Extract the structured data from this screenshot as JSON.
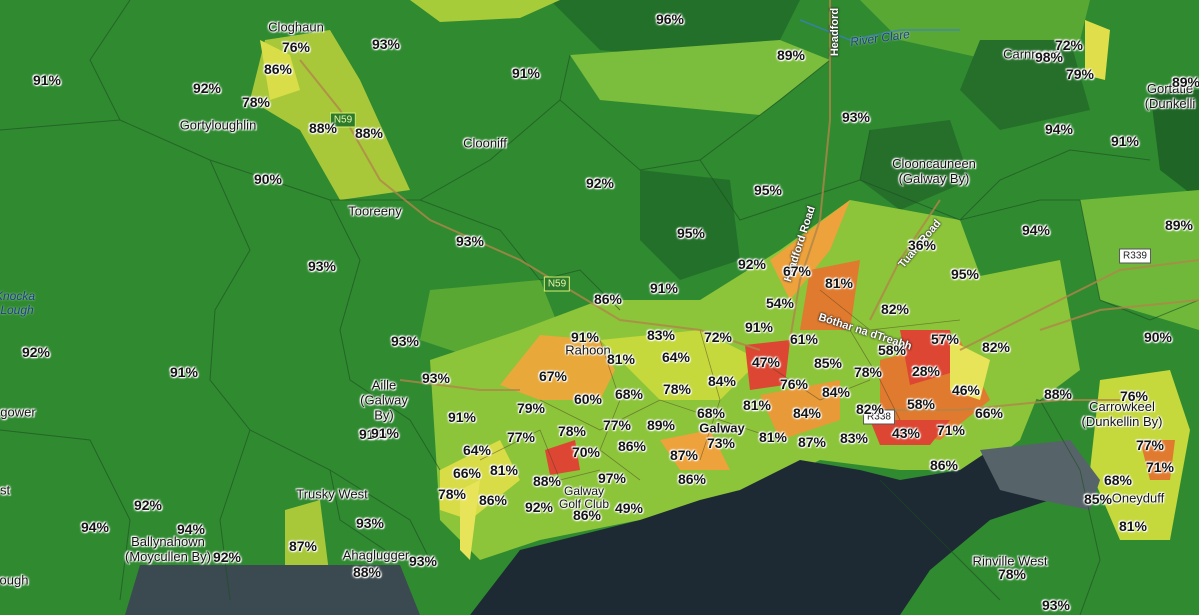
{
  "colors": {
    "background_green": "#2f8a30",
    "dark_green": "#23702a",
    "mid_green": "#3f9a35",
    "light_green": "#6fb83a",
    "yellow_green": "#c5d83c",
    "yellow": "#e8e45a",
    "orange": "#eea23c",
    "dark_orange": "#e07a2e",
    "red": "#dc4632",
    "sea": "#1d2a33"
  },
  "places": {
    "cloghaun": "Cloghaun",
    "gortyloughlin": "Gortyloughlin",
    "clooniff": "Clooniff",
    "tooreeny": "Tooreeny",
    "knocka": "Knocka",
    "lough": "Lough",
    "aille_1": "Aille",
    "aille_2": "(Galway",
    "aille_3": "By)",
    "rahoon": "Rahoon",
    "galway": "Galway",
    "golf_1": "Galway",
    "golf_2": "Golf Club",
    "trusky": "Trusky West",
    "ballynahown_1": "Ballynahown",
    "ballynahown_2": "(Moycullen By)",
    "ahaglugger": "Ahaglugger",
    "gower": "gower",
    "ough": "ough",
    "clooncauneen_1": "Clooncauneen",
    "clooncauneen_2": "(Galway By)",
    "carrowkeel_1": "Carrowkeel",
    "carrowkeel_2": "(Dunkellin By)",
    "gortatle_1": "Gortatle",
    "gortatle_2": "(Dunkelli",
    "carnmore": "Carnmore",
    "rinville": "Rinville West",
    "oranmore": "Oneyduff",
    "st": "st"
  },
  "water": {
    "river_clare": "River Clare"
  },
  "roads": {
    "headford_1": "Headford",
    "headford_2": "Headford Road",
    "tuam": "Tuam Road",
    "bothar": "Bóthar na dTreabh"
  },
  "shields": {
    "n59_a": "N59",
    "n59_b": "N59",
    "r339": "R339",
    "r338": "R338"
  },
  "percentages": {
    "p01": "96%",
    "p02": "93%",
    "p03": "91%",
    "p04": "76%",
    "p05": "86%",
    "p06": "92%",
    "p07": "78%",
    "p08": "88%",
    "p09": "88%",
    "p10": "91%",
    "p11": "89%",
    "p12": "72%",
    "p13": "79%",
    "p14": "93%",
    "p15": "94%",
    "p16": "91%",
    "p17": "90%",
    "p18": "92%",
    "p19": "95%",
    "p20": "95%",
    "p21": "93%",
    "p22": "93%",
    "p23": "92%",
    "p24": "67%",
    "p25": "81%",
    "p26": "86%",
    "p27": "91%",
    "p28": "95%",
    "p29": "94%",
    "p30": "89%",
    "p31": "54%",
    "p32": "82%",
    "p33": "92%",
    "p34": "91%",
    "p35": "83%",
    "p36": "72%",
    "p37": "91%",
    "p38": "61%",
    "p39": "57%",
    "p40": "81%",
    "p41": "64%",
    "p42": "58%",
    "p43": "82%",
    "p44": "90%",
    "p45": "67%",
    "p46": "47%",
    "p47": "85%",
    "p48": "28%",
    "p49": "93%",
    "p50": "91%",
    "p51": "60%",
    "p52": "68%",
    "p53": "78%",
    "p54": "84%",
    "p55": "76%",
    "p56": "84%",
    "p57": "78%",
    "p58": "46%",
    "p59": "88%",
    "p60": "76%",
    "p61": "79%",
    "p62": "78%",
    "p63": "68%",
    "p64": "81%",
    "p65": "84%",
    "p66": "82%",
    "p67": "58%",
    "p68": "66%",
    "p69": "91%",
    "p70": "91%",
    "p71": "77%",
    "p72": "77%",
    "p73": "89%",
    "p74": "64%",
    "p75": "70%",
    "p76": "86%",
    "p77": "73%",
    "p78": "81%",
    "p79": "87%",
    "p80": "83%",
    "p81": "43%",
    "p82": "71%",
    "p83": "77%",
    "p84": "71%",
    "p85": "66%",
    "p86": "81%",
    "p87": "88%",
    "p88": "97%",
    "p89": "87%",
    "p90": "86%",
    "p91": "86%",
    "p92": "68%",
    "p93": "78%",
    "p94": "86%",
    "p95": "92%",
    "p96": "86%",
    "p97": "49%",
    "p98": "85%",
    "p99": "92%",
    "p100": "94%",
    "p101": "94%",
    "p102": "92%",
    "p103": "87%",
    "p104": "93%",
    "p105": "88%",
    "p106": "93%",
    "p107": "78%",
    "p108": "93%",
    "p109": "81%",
    "p110": "91%",
    "p111": "89%",
    "p112": "36%",
    "p113": "93%",
    "p114": "98%"
  }
}
